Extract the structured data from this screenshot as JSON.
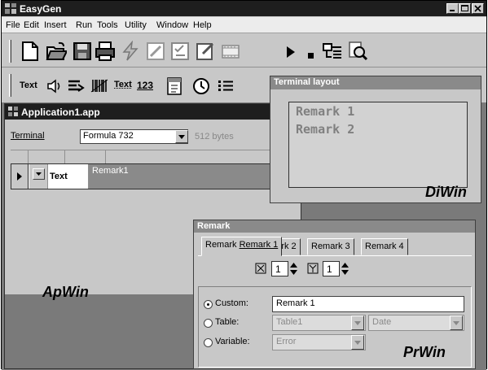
{
  "main": {
    "title": "EasyGen",
    "menu": [
      "File",
      "Edit",
      "Insert",
      "Run",
      "Tools",
      "Utility",
      "Window",
      "Help"
    ]
  },
  "toolbar2": {
    "text_tool": "Text",
    "text_tool2": "Text",
    "digits_tool": "123"
  },
  "application": {
    "title": "Application1.app",
    "terminal_label": "Terminal",
    "terminal_value": "Formula 732",
    "memory": "512 bytes",
    "row": {
      "type_label": "Text",
      "value": "Remark1"
    },
    "callout": "ApWin"
  },
  "terminal_layout": {
    "title": "Terminal layout",
    "lines": [
      "Remark 1",
      "Remark 2"
    ],
    "callout": "DiWin"
  },
  "remark": {
    "title": "Remark",
    "tabs": [
      "Remark 1",
      "Remark 2",
      "Remark 3",
      "Remark 4"
    ],
    "x_value": "1",
    "y_value": "1",
    "options": {
      "custom_label": "Custom:",
      "custom_value": "Remark 1",
      "table_label": "Table:",
      "table_value": "Table1",
      "table_field": "Date",
      "variable_label": "Variable:",
      "variable_value": "Error"
    },
    "callout": "PrWin"
  }
}
